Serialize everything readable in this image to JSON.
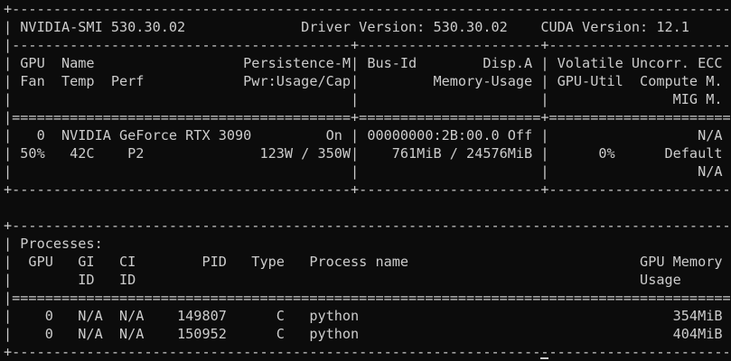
{
  "terminal": {
    "lines": [
      "+---------------------------------------------------------------------------------------+",
      "| NVIDIA-SMI 530.30.02              Driver Version: 530.30.02    CUDA Version: 12.1     |",
      "|-----------------------------------------+----------------------+----------------------+",
      "| GPU  Name                  Persistence-M| Bus-Id        Disp.A | Volatile Uncorr. ECC |",
      "| Fan  Temp  Perf            Pwr:Usage/Cap|         Memory-Usage | GPU-Util  Compute M. |",
      "|                                         |                      |               MIG M. |",
      "|=========================================+======================+======================|",
      "|   0  NVIDIA GeForce RTX 3090         On | 00000000:2B:00.0 Off |                  N/A |",
      "| 50%   42C    P2              123W / 350W|    761MiB / 24576MiB |      0%      Default |",
      "|                                         |                      |                  N/A |",
      "+-----------------------------------------+----------------------+----------------------+",
      "",
      "+---------------------------------------------------------------------------------------+",
      "| Processes:                                                                            |",
      "|  GPU   GI   CI        PID   Type   Process name                            GPU Memory |",
      "|        ID   ID                                                             Usage      |",
      "|=======================================================================================|",
      "|    0   N/A  N/A    149807      C   python                                      354MiB |",
      "|    0   N/A  N/A    150952      C   python                                      404MiB |",
      "+---------------------------------------------------------------------------------------+"
    ]
  }
}
